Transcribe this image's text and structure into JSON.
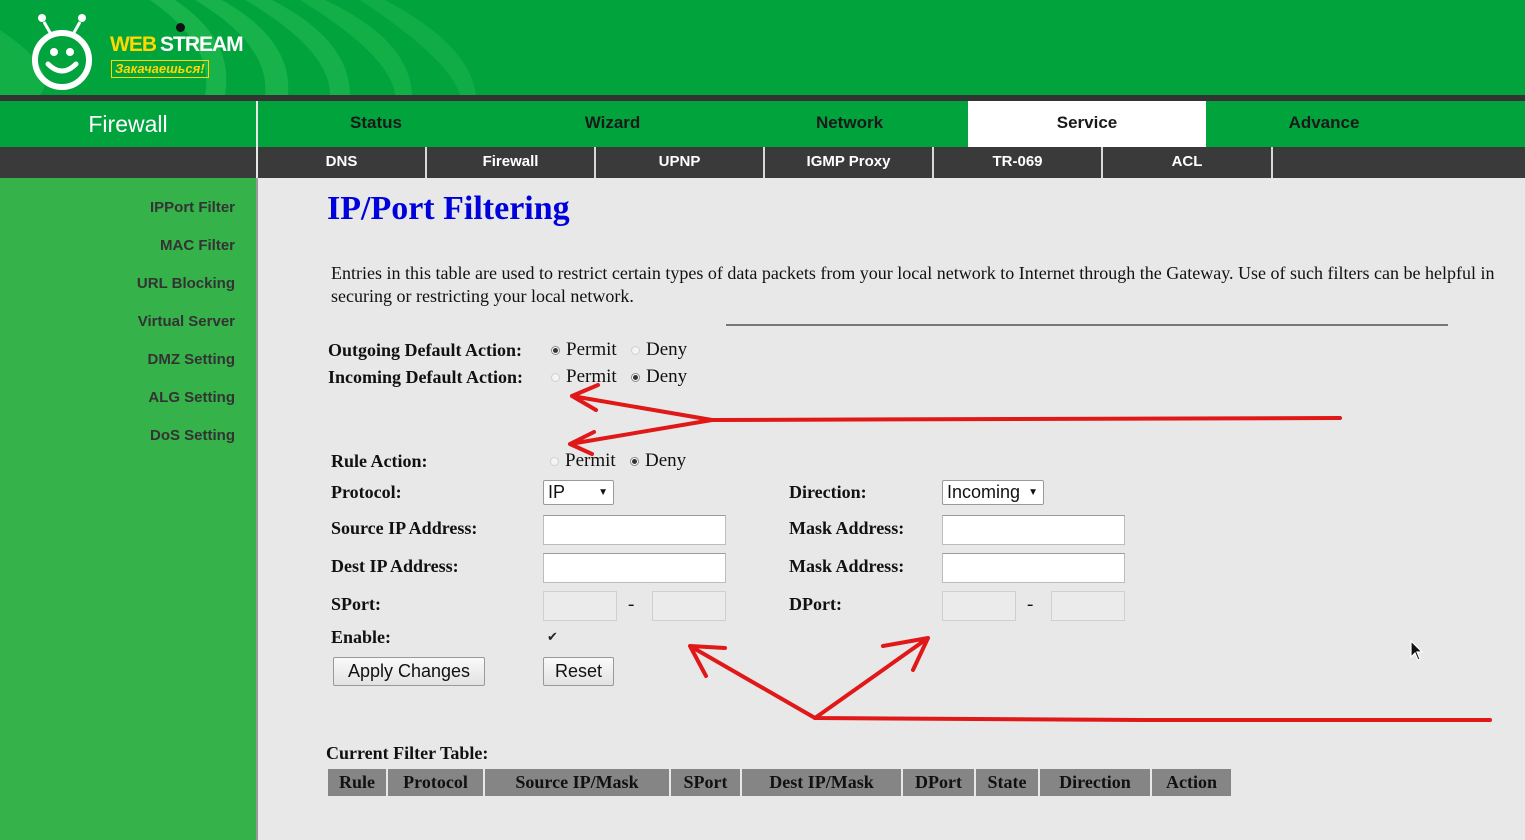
{
  "brand": {
    "word1": "WEB",
    "word2": "STREAM",
    "slogan": "Закачаешься!",
    "colors": {
      "green": "#00a33c",
      "yellow": "#ffd800"
    }
  },
  "section_title": "Firewall",
  "main_tabs": [
    {
      "label": "Status",
      "active": false
    },
    {
      "label": "Wizard",
      "active": false
    },
    {
      "label": "Network",
      "active": false
    },
    {
      "label": "Service",
      "active": true
    },
    {
      "label": "Advance",
      "active": false
    }
  ],
  "sub_tabs": [
    {
      "label": "DNS"
    },
    {
      "label": "Firewall"
    },
    {
      "label": "UPNP"
    },
    {
      "label": "IGMP Proxy"
    },
    {
      "label": "TR-069"
    },
    {
      "label": "ACL"
    }
  ],
  "sidebar": {
    "items": [
      {
        "label": "IPPort Filter"
      },
      {
        "label": "MAC Filter"
      },
      {
        "label": "URL Blocking"
      },
      {
        "label": "Virtual Server"
      },
      {
        "label": "DMZ Setting"
      },
      {
        "label": "ALG Setting"
      },
      {
        "label": "DoS Setting"
      }
    ]
  },
  "page": {
    "title": "IP/Port Filtering",
    "description": "Entries in this table are used to restrict certain types of data packets from your local network to Internet through the Gateway. Use of such filters can be helpful in securing or restricting your local network."
  },
  "defaults": {
    "outgoing": {
      "label": "Outgoing Default Action:",
      "permit_label": "Permit",
      "deny_label": "Deny",
      "selected": "Permit"
    },
    "incoming": {
      "label": "Incoming Default Action:",
      "permit_label": "Permit",
      "deny_label": "Deny",
      "selected": "Deny"
    }
  },
  "rule_form": {
    "rule_action": {
      "label": "Rule Action:",
      "permit_label": "Permit",
      "deny_label": "Deny",
      "selected": "Deny"
    },
    "protocol": {
      "label": "Protocol:",
      "value": "IP"
    },
    "direction": {
      "label": "Direction:",
      "value": "Incoming"
    },
    "source_ip": {
      "label": "Source IP Address:",
      "value": ""
    },
    "source_mask": {
      "label": "Mask Address:",
      "value": ""
    },
    "dest_ip": {
      "label": "Dest IP Address:",
      "value": ""
    },
    "dest_mask": {
      "label": "Mask Address:",
      "value": ""
    },
    "sport": {
      "label": "SPort:",
      "from": "",
      "to": "",
      "separator": "-"
    },
    "dport": {
      "label": "DPort:",
      "from": "",
      "to": "",
      "separator": "-"
    },
    "enable": {
      "label": "Enable:",
      "checked": true
    },
    "apply_label": "Apply Changes",
    "reset_label": "Reset"
  },
  "filter_table": {
    "title": "Current Filter Table:",
    "columns": [
      "Rule",
      "Protocol",
      "Source IP/Mask",
      "SPort",
      "Dest IP/Mask",
      "DPort",
      "State",
      "Direction",
      "Action"
    ],
    "rows": []
  },
  "annotations": {
    "arrow_color": "#e01818"
  },
  "icons": {
    "cursor": "mouse-pointer-icon",
    "logo": "smiley-tv-logo-icon"
  }
}
